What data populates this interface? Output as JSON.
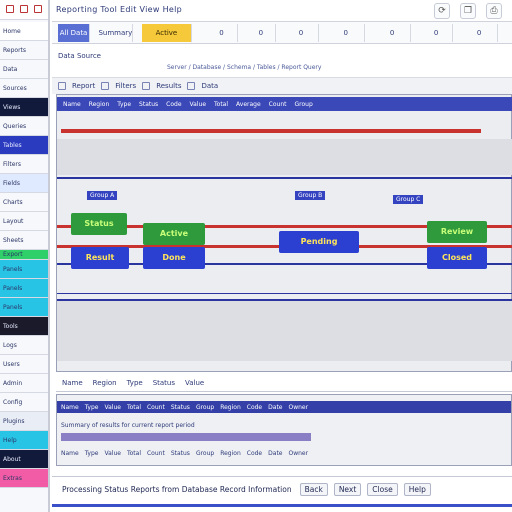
{
  "app": {
    "title": "Reporting Tool  Edit  View  Help"
  },
  "sidebar": {
    "items": [
      {
        "label": "Home",
        "color": "#ffffff"
      },
      {
        "label": "Reports",
        "color": "#f7f8fb"
      },
      {
        "label": "Data",
        "color": "#f7f8fb"
      },
      {
        "label": "Sources",
        "color": "#f7f8fb"
      },
      {
        "label": "Views",
        "color": "#111a3a"
      },
      {
        "label": "Queries",
        "color": "#f7f8fb"
      },
      {
        "label": "Tables",
        "color": "#2a3bc0"
      },
      {
        "label": "Filters",
        "color": "#f7f8fb"
      },
      {
        "label": "Fields",
        "color": "#dfe9ff"
      },
      {
        "label": "Charts",
        "color": "#f7f8fb"
      },
      {
        "label": "Layout",
        "color": "#f7f8fb"
      },
      {
        "label": "Sheets",
        "color": "#f7f8fb"
      },
      {
        "label": "Export",
        "color": "#2fd06a"
      },
      {
        "label": "Panels",
        "color": "#28c4e6"
      },
      {
        "label": "Panels",
        "color": "#28c4e6"
      },
      {
        "label": "Panels",
        "color": "#28c4e6"
      },
      {
        "label": "Tools",
        "color": "#1a1a2a"
      },
      {
        "label": "Logs",
        "color": "#f7f8fb"
      },
      {
        "label": "Users",
        "color": "#f7f8fb"
      },
      {
        "label": "Admin",
        "color": "#f7f8fb"
      },
      {
        "label": "Config",
        "color": "#f7f8fb"
      },
      {
        "label": "Plugins",
        "color": "#e8edf6"
      },
      {
        "label": "Help",
        "color": "#28c4e6"
      },
      {
        "label": "About",
        "color": "#111a3a"
      },
      {
        "label": "Extras",
        "color": "#f25ca6"
      }
    ]
  },
  "toolbar": {
    "icons": [
      "refresh-icon",
      "copy-icon",
      "print-icon",
      "undo-icon"
    ]
  },
  "tabs": [
    {
      "label": "All Data",
      "style": "active-blue"
    },
    {
      "label": "Summary",
      "style": ""
    },
    {
      "label": "Active",
      "style": "active-yellow"
    },
    {
      "label": "0",
      "style": ""
    },
    {
      "label": "0",
      "style": ""
    },
    {
      "label": "0",
      "style": ""
    },
    {
      "label": "0",
      "style": ""
    },
    {
      "label": "0",
      "style": ""
    },
    {
      "label": "0",
      "style": ""
    },
    {
      "label": "0",
      "style": ""
    }
  ],
  "subbar": {
    "label": "Data Source",
    "path": "Server / Database / Schema / Tables / Report Query"
  },
  "breadcrumbs": [
    "Report",
    "Filters",
    "Results",
    "Data"
  ],
  "grid": {
    "header_cells": [
      "Name",
      "Region",
      "Type",
      "Status",
      "Code",
      "Value",
      "Total",
      "Average",
      "Count",
      "Group"
    ],
    "section_labels": [
      "Group A",
      "Group B",
      "Group C"
    ],
    "chips": [
      {
        "label": "Status",
        "style": "green"
      },
      {
        "label": "Result",
        "style": "blue"
      },
      {
        "label": "Active",
        "style": "green"
      },
      {
        "label": "Done",
        "style": "blue"
      },
      {
        "label": "Pending",
        "style": "blue"
      },
      {
        "label": "Review",
        "style": "green"
      },
      {
        "label": "Closed",
        "style": "blue"
      }
    ]
  },
  "lower": {
    "header_items": [
      "Name",
      "Region",
      "Type",
      "Status",
      "Value"
    ],
    "rows": [
      {
        "cells": [
          "Name",
          "Type",
          "Value",
          "Total",
          "Count",
          "Status",
          "Group",
          "Region",
          "Code",
          "Date",
          "Owner"
        ],
        "style": "dark"
      },
      {
        "cells": [
          "Summary of results for current report period"
        ],
        "style": "light"
      },
      {
        "cells": [
          "Name",
          "Type",
          "Value",
          "Total",
          "Count",
          "Status",
          "Group",
          "Region",
          "Code",
          "Date",
          "Owner"
        ],
        "style": "light"
      }
    ]
  },
  "status": {
    "text": "Processing Status Reports from Database Record Information",
    "items": [
      "Back",
      "Next",
      "Close",
      "Help"
    ]
  }
}
